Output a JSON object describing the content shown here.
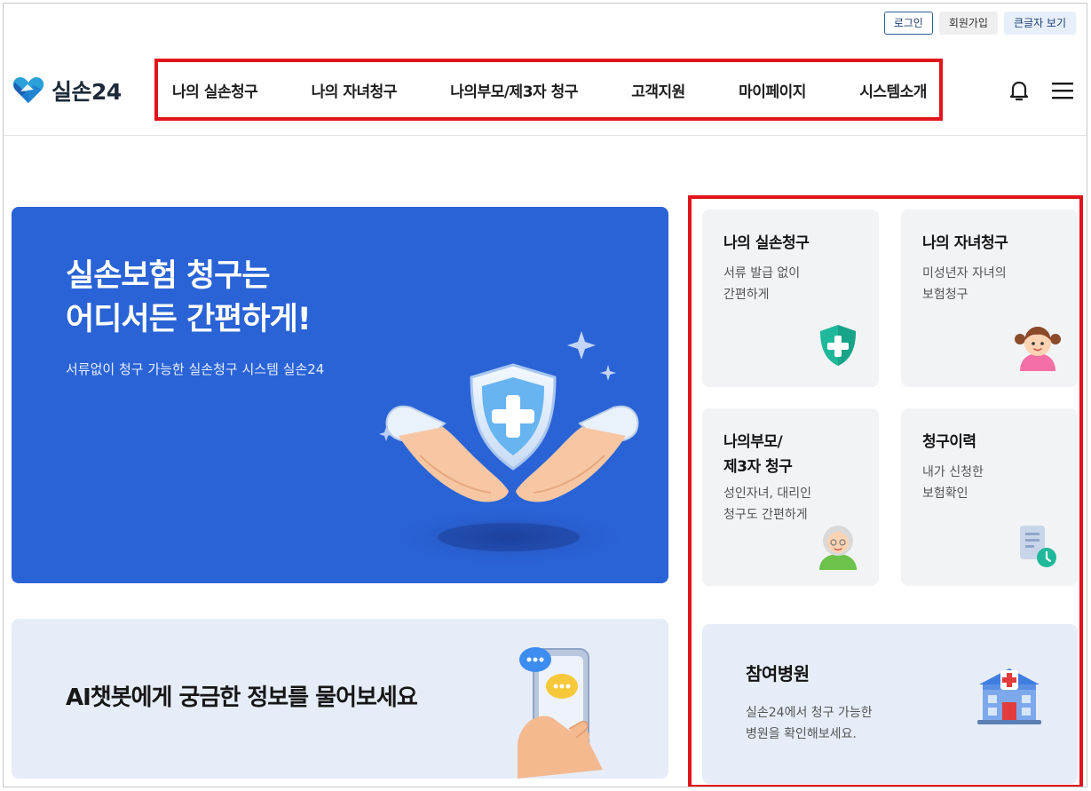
{
  "top_bar": {
    "login_label": "로그인",
    "join_label": "회원가입",
    "large_text_label": "큰글자 보기"
  },
  "brand": {
    "name": "실손24",
    "accent": "#2a63d6",
    "highlight_border": "#e1141c"
  },
  "nav": {
    "items": [
      "나의 실손청구",
      "나의 자녀청구",
      "나의부모/제3자 청구",
      "고객지원",
      "마이페이지",
      "시스템소개"
    ]
  },
  "header_icons": {
    "bell": "bell-icon",
    "menu": "hamburger-menu-icon"
  },
  "hero": {
    "title_line1": "실손보험 청구는",
    "title_line2": "어디서든 간편하게!",
    "subtitle": "서류없이 청구 가능한 실손청구 시스템 실손24"
  },
  "chatbot": {
    "text": "AI챗봇에게 궁금한 정보를 물어보세요"
  },
  "service_cards": [
    {
      "title": "나의 실손청구",
      "desc_line1": "서류 발급 없이",
      "desc_line2": "간편하게",
      "icon": "shield-plus-icon"
    },
    {
      "title": "나의 자녀청구",
      "desc_line1": "미성년자 자녀의",
      "desc_line2": "보험청구",
      "icon": "child-icon"
    },
    {
      "title_line1": "나의부모/",
      "title_line2": "제3자 청구",
      "desc_line1": "성인자녀, 대리인",
      "desc_line2": "청구도 간편하게",
      "icon": "grandparent-icon"
    },
    {
      "title": "청구이력",
      "desc_line1": "내가 신청한",
      "desc_line2": "보험확인",
      "icon": "document-clock-icon"
    }
  ],
  "hospital_card": {
    "title": "참여병원",
    "desc_line1": "실손24에서 청구 가능한",
    "desc_line2": "병원을 확인해보세요.",
    "icon": "hospital-icon"
  }
}
